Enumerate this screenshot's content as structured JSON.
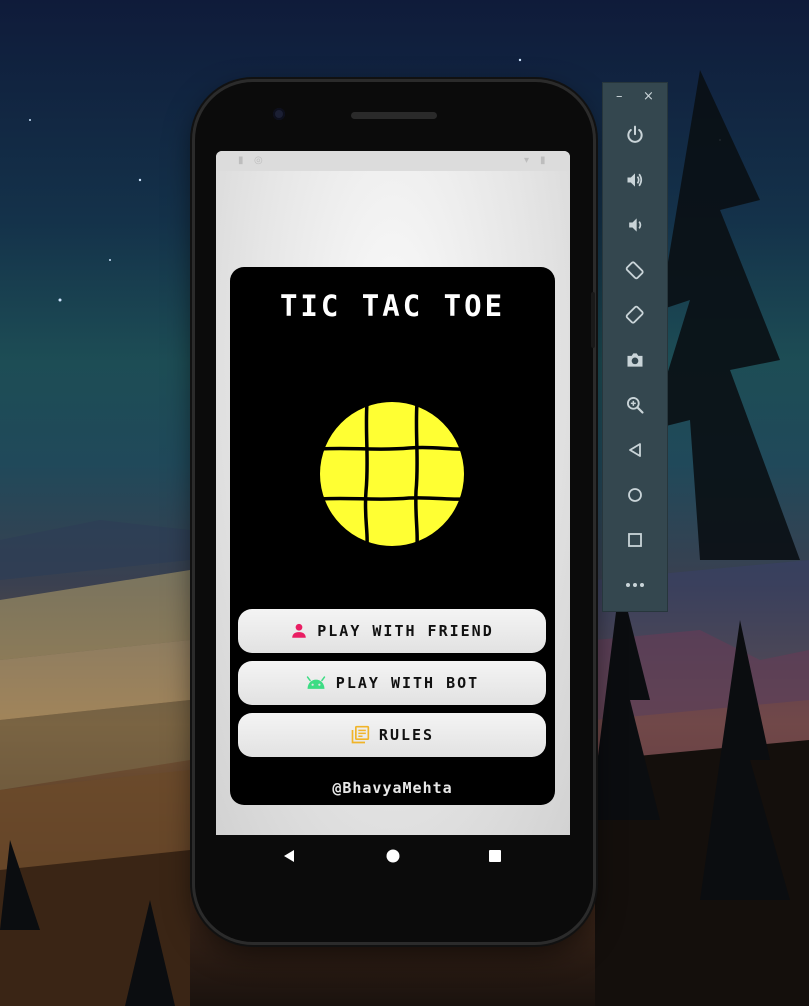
{
  "app": {
    "title": "TIC TAC TOE",
    "footer": "@BhavyaMehta"
  },
  "menu": [
    {
      "label": "PLAY WITH FRIEND",
      "icon": "person-icon",
      "icon_color": "#e91e63"
    },
    {
      "label": "PLAY WITH BOT",
      "icon": "android-icon",
      "icon_color": "#3ddc84"
    },
    {
      "label": "RULES",
      "icon": "library-books-icon",
      "icon_color": "#f0b429"
    }
  ],
  "logo": {
    "fill": "#ffff33",
    "grid_color": "#000000"
  },
  "android_nav": [
    "back-icon",
    "home-icon",
    "recents-icon"
  ],
  "emulator_toolbar": {
    "window_controls": [
      "minimize",
      "close"
    ],
    "minimize_glyph": "–",
    "close_glyph": "×",
    "items": [
      "power-icon",
      "volume-up-icon",
      "volume-down-icon",
      "rotate-left-icon",
      "rotate-right-icon",
      "screenshot-icon",
      "zoom-icon",
      "back-icon",
      "home-icon",
      "overview-icon",
      "more-icon"
    ]
  },
  "colors": {
    "card_bg": "#000000",
    "toolbar_bg": "#34474f",
    "toolbar_icon": "#c9d4d8"
  }
}
